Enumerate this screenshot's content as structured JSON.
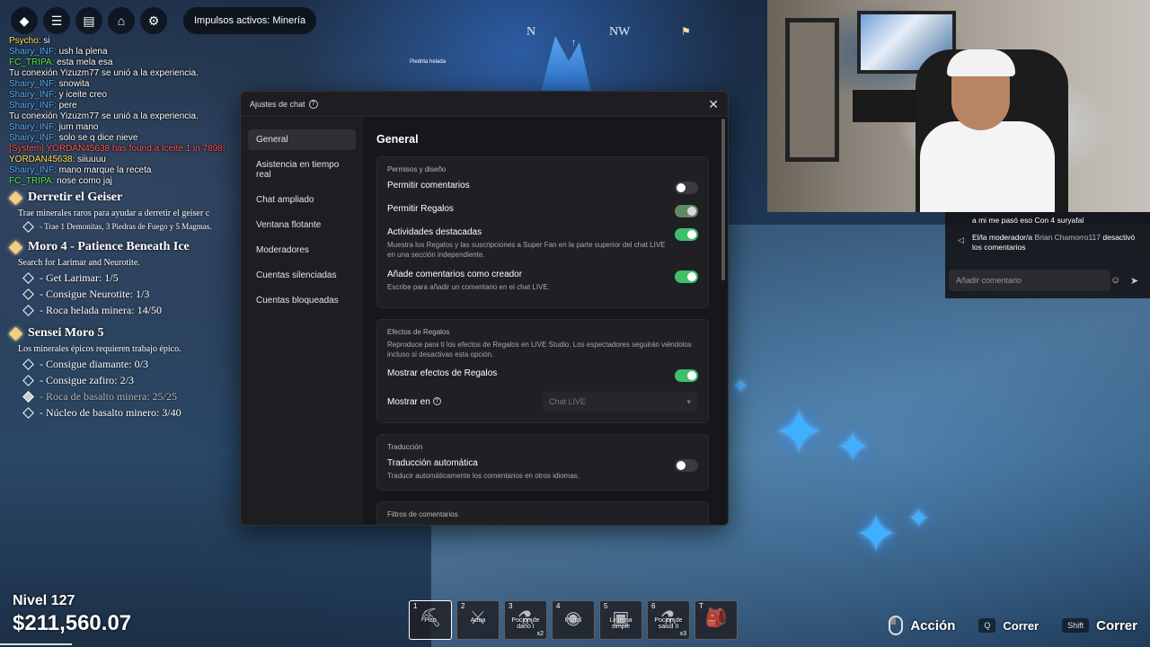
{
  "topbar": {
    "active_boosts": "Impulsos activos: Minería"
  },
  "compass": {
    "n": "N",
    "nw": "NW",
    "tick": "↑"
  },
  "world_label": {
    "name": "Piedrita helada"
  },
  "chat_log": [
    {
      "user": "Psycho:",
      "msg": " si",
      "color": "yellow"
    },
    {
      "user": "Shairy_INF:",
      "msg": " ush la plena",
      "color": "blue"
    },
    {
      "user": "FC_TRIPA:",
      "msg": " esta mela esa",
      "color": "green"
    },
    {
      "user": "",
      "msg": "Tu conexión Yizuzm77 se unió a la experiencia.",
      "color": "white"
    },
    {
      "user": "Shairy_INF:",
      "msg": " snowita",
      "color": "blue"
    },
    {
      "user": "Shairy_INF:",
      "msg": " y iceite creo",
      "color": "blue"
    },
    {
      "user": "Shairy_INF:",
      "msg": " pere",
      "color": "blue"
    },
    {
      "user": "",
      "msg": "Tu conexión Yizuzm77 se unió a la experiencia.",
      "color": "white"
    },
    {
      "user": "Shairy_INF:",
      "msg": " jum mano",
      "color": "blue"
    },
    {
      "user": "Shairy_INF:",
      "msg": " solo se q dice nieve",
      "color": "blue"
    },
    {
      "user": "",
      "msg": "[System] YORDAN45638 has found a Iceite 1 in 7898!",
      "color": "sys"
    },
    {
      "user": "YORDAN45638:",
      "msg": " siiuuuu",
      "color": "yellow"
    },
    {
      "user": "Shairy_INF:",
      "msg": " mano marque la receta",
      "color": "blue"
    },
    {
      "user": "FC_TRIPA:",
      "msg": " nose como jaj",
      "color": "green"
    }
  ],
  "quests": [
    {
      "title": "Derretir el Geiser",
      "desc": "Trae minerales raros para ayudar a derretir el geiser c",
      "items": [
        {
          "text": "- Trae 1 Demonitas, 3 Piedras de Fuego y 5 Magmas.",
          "done": false,
          "small": true
        }
      ]
    },
    {
      "title": "Moro 4 - Patience Beneath Ice",
      "desc": "Search for Larimar and Neurotite.",
      "items": [
        {
          "text": "- Get Larimar: 1/5",
          "done": false,
          "small": false
        },
        {
          "text": "- Consigue Neurotite: 1/3",
          "done": false,
          "small": false
        },
        {
          "text": "- Roca helada minera: 14/50",
          "done": false,
          "small": false
        }
      ]
    },
    {
      "title": "Sensei Moro 5",
      "desc": "Los minerales épicos requieren trabajo épico.",
      "items": [
        {
          "text": "- Consigue diamante: 0/3",
          "done": false,
          "small": false
        },
        {
          "text": "- Consigue zafiro: 2/3",
          "done": false,
          "small": false
        },
        {
          "text": "- Roca de basalto minera: 25/25",
          "done": true,
          "small": false
        },
        {
          "text": "- Núcleo de basalto minero: 3/40",
          "done": false,
          "small": false
        }
      ]
    }
  ],
  "player": {
    "level": "Nivel 127",
    "money": "$211,560.07"
  },
  "hotbar": [
    {
      "num": "1",
      "label": "Pico",
      "qty": "",
      "glyph": "⛏"
    },
    {
      "num": "2",
      "label": "Arma",
      "qty": "",
      "glyph": "⚔"
    },
    {
      "num": "3",
      "label": "Poción de daño I",
      "qty": "x2",
      "glyph": "⚗"
    },
    {
      "num": "4",
      "label": "Portal",
      "qty": "",
      "glyph": "◉"
    },
    {
      "num": "5",
      "label": "Linterna simple",
      "qty": "",
      "glyph": "▣"
    },
    {
      "num": "6",
      "label": "Poción de salud II",
      "qty": "x3",
      "glyph": "⚗"
    },
    {
      "num": "T",
      "label": "",
      "qty": "",
      "glyph": "🎒"
    }
  ],
  "hints": {
    "action": "Acción",
    "q_key": "Q",
    "run1": "Correr",
    "shift_key": "Shift",
    "run2": "Correr"
  },
  "live_chat": {
    "msg1": "a mi me pasó eso Con 4 suryafal",
    "mod_prefix": "El/la moderador/a ",
    "mod_name": "Brian Chamorro117",
    "mod_suffix": " desactivó los comentarios",
    "input_placeholder": "Añadir comentario"
  },
  "modal": {
    "title": "Ajustes de chat",
    "nav": [
      {
        "label": "General",
        "active": true
      },
      {
        "label": "Asistencia en tiempo real",
        "active": false
      },
      {
        "label": "Chat ampliado",
        "active": false
      },
      {
        "label": "Ventana flotante",
        "active": false
      },
      {
        "label": "Moderadores",
        "active": false
      },
      {
        "label": "Cuentas silenciadas",
        "active": false
      },
      {
        "label": "Cuentas bloqueadas",
        "active": false
      }
    ],
    "heading": "General",
    "permisos": {
      "title": "Permisos y diseño",
      "rows": [
        {
          "label": "Permitir comentarios",
          "desc": "",
          "state": "off"
        },
        {
          "label": "Permitir Regalos",
          "desc": "",
          "state": "on-dim"
        },
        {
          "label": "Actividades destacadas",
          "desc": "Muestra los Regalos y las suscripciones a Super Fan en la parte superior del chat LIVE en una sección independiente.",
          "state": "on"
        },
        {
          "label": "Añade comentarios como creador",
          "desc": "Escribe para añadir un comentario en el chat LIVE.",
          "state": "on"
        }
      ]
    },
    "efectos": {
      "title": "Efectos de Regalos",
      "desc": "Reproduce para ti los efectos de Regalos en LIVE Studio. Los espectadores seguirán viéndolos incluso si desactivas esta opción.",
      "show_label": "Mostrar efectos de Regalos",
      "show_state": "on",
      "show_in_label": "Mostrar en",
      "show_in_value": "Chat LIVE"
    },
    "traduccion": {
      "title": "Traducción",
      "label": "Traducción automática",
      "desc": "Traducir automáticamente los comentarios en otros idiomas.",
      "state": "off"
    },
    "filtros": {
      "title": "Filtros de comentarios"
    }
  }
}
